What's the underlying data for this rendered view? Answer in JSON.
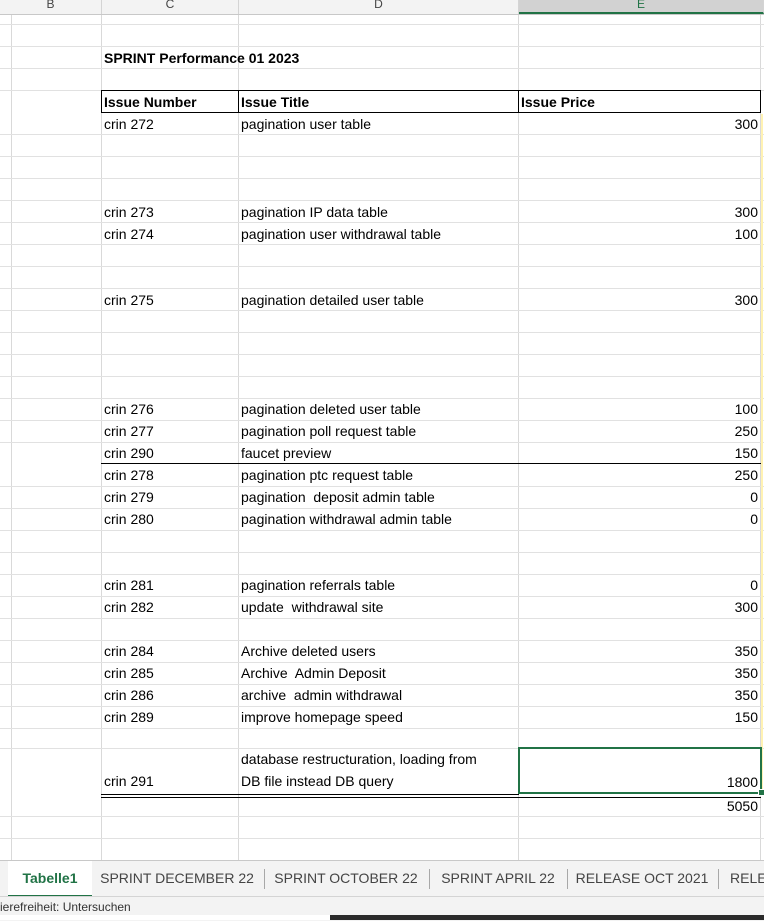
{
  "columns": [
    {
      "id": "B",
      "label": "B"
    },
    {
      "id": "C",
      "label": "C"
    },
    {
      "id": "D",
      "label": "D"
    },
    {
      "id": "E",
      "label": "E"
    }
  ],
  "sheet_title": "SPRINT Performance 01 2023",
  "table": {
    "headers": {
      "number": "Issue Number",
      "title": "Issue Title",
      "price": "Issue Price"
    },
    "rows": [
      {
        "number": "crin 272",
        "title": "pagination user table",
        "price": "300"
      },
      {
        "number": "crin 273",
        "title": "pagination IP data table",
        "price": "300"
      },
      {
        "number": "crin 274",
        "title": "pagination user withdrawal table",
        "price": "100"
      },
      {
        "number": "crin 275",
        "title": "pagination detailed user table",
        "price": "300"
      },
      {
        "number": "crin 276",
        "title": "pagination deleted user table",
        "price": "100"
      },
      {
        "number": "crin 277",
        "title": "pagination poll request table",
        "price": "250"
      },
      {
        "number": "crin 290",
        "title": "faucet preview",
        "price": "150"
      },
      {
        "number": "crin 278",
        "title": "pagination ptc request table",
        "price": "250"
      },
      {
        "number": "crin 279",
        "title": "pagination  deposit admin table",
        "price": "0"
      },
      {
        "number": "crin 280",
        "title": "pagination withdrawal admin table",
        "price": "0"
      },
      {
        "number": "crin 281",
        "title": "pagination referrals table",
        "price": "0"
      },
      {
        "number": "crin 282",
        "title": "update  withdrawal site",
        "price": "300"
      },
      {
        "number": "crin 284",
        "title": "Archive deleted users",
        "price": "350"
      },
      {
        "number": "crin 285",
        "title": "Archive  Admin Deposit",
        "price": "350"
      },
      {
        "number": "crin 286",
        "title": "archive  admin withdrawal",
        "price": "350"
      },
      {
        "number": "crin 289",
        "title": "improve homepage speed",
        "price": "150"
      },
      {
        "number": "crin 291",
        "title_line1": "database restructuration, loading from",
        "title_line2": "DB file instead DB query",
        "price": "1800"
      }
    ],
    "total": "5050"
  },
  "tabs": [
    {
      "label": "Tabelle1",
      "active": true
    },
    {
      "label": "SPRINT DECEMBER 22",
      "active": false
    },
    {
      "label": "SPRINT OCTOBER 22",
      "active": false
    },
    {
      "label": "SPRINT APRIL 22",
      "active": false
    },
    {
      "label": "RELEASE OCT 2021",
      "active": false
    },
    {
      "label": "RELE",
      "active": false
    }
  ],
  "status_text": "ierefreiheit: Untersuchen",
  "colors": {
    "accent": "#217346",
    "grid": "#d9d9d9"
  }
}
